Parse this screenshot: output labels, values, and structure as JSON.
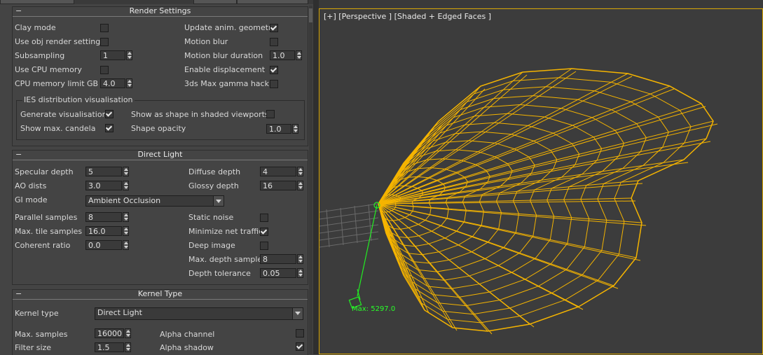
{
  "render_settings": {
    "title": "Render Settings",
    "collapse_symbol": "−",
    "left": [
      {
        "label": "Clay mode",
        "type": "checkbox",
        "checked": false
      },
      {
        "label": "Use obj render settings",
        "type": "checkbox",
        "checked": false
      },
      {
        "label": "Subsampling",
        "type": "spinner",
        "value": "1"
      },
      {
        "label": "Use CPU memory",
        "type": "checkbox",
        "checked": false
      },
      {
        "label": "CPU memory limit GB",
        "type": "spinner",
        "value": "4.0"
      }
    ],
    "right": [
      {
        "label": "Update anim. geometry",
        "type": "checkbox",
        "checked": true
      },
      {
        "label": "Motion blur",
        "type": "checkbox",
        "checked": false
      },
      {
        "label": "Motion blur duration",
        "type": "spinner",
        "value": "1.0"
      },
      {
        "label": "Enable displacement",
        "type": "checkbox",
        "checked": true
      },
      {
        "label": "3ds Max gamma hack",
        "type": "checkbox",
        "checked": false
      }
    ],
    "ies_group": {
      "title": "IES distribution visualisation",
      "generate_label": "Generate visualisation",
      "generate_checked": true,
      "show_candela_label": "Show max. candela",
      "show_candela_checked": true,
      "show_shape_label": "Show as shape in shaded viewports",
      "show_shape_checked": false,
      "shape_opacity_label": "Shape opacity",
      "shape_opacity_value": "1.0"
    }
  },
  "direct_light": {
    "title": "Direct Light",
    "collapse_symbol": "−",
    "specular_depth_label": "Specular depth",
    "specular_depth_value": "5",
    "ao_dists_label": "AO dists",
    "ao_dists_value": "3.0",
    "gi_mode_label": "GI mode",
    "gi_mode_value": "Ambient Occlusion",
    "parallel_samples_label": "Parallel samples",
    "parallel_samples_value": "8",
    "max_tile_samples_label": "Max. tile samples",
    "max_tile_samples_value": "16.0",
    "coherent_ratio_label": "Coherent ratio",
    "coherent_ratio_value": "0.0",
    "diffuse_depth_label": "Diffuse depth",
    "diffuse_depth_value": "4",
    "glossy_depth_label": "Glossy depth",
    "glossy_depth_value": "16",
    "static_noise_label": "Static noise",
    "static_noise_checked": false,
    "minimize_net_label": "Minimize net traffic",
    "minimize_net_checked": true,
    "deep_image_label": "Deep image",
    "deep_image_checked": false,
    "max_depth_samples_label": "Max. depth samples",
    "max_depth_samples_value": "8",
    "depth_tolerance_label": "Depth tolerance",
    "depth_tolerance_value": "0.05"
  },
  "kernel_type": {
    "title": "Kernel Type",
    "collapse_symbol": "−",
    "kernel_type_label": "Kernel type",
    "kernel_type_value": "Direct Light",
    "max_samples_label": "Max. samples",
    "max_samples_value": "16000",
    "filter_size_label": "Filter size",
    "filter_size_value": "1.5",
    "alpha_channel_label": "Alpha channel",
    "alpha_channel_checked": false,
    "alpha_shadow_label": "Alpha shadow",
    "alpha_shadow_checked": true
  },
  "viewport": {
    "label": "[+] [Perspective ] [Shaded + Edged Faces ]",
    "max_label": "Max: 5297.0",
    "wire_color": "#f5b400",
    "gizmo_color": "#22ee22"
  }
}
